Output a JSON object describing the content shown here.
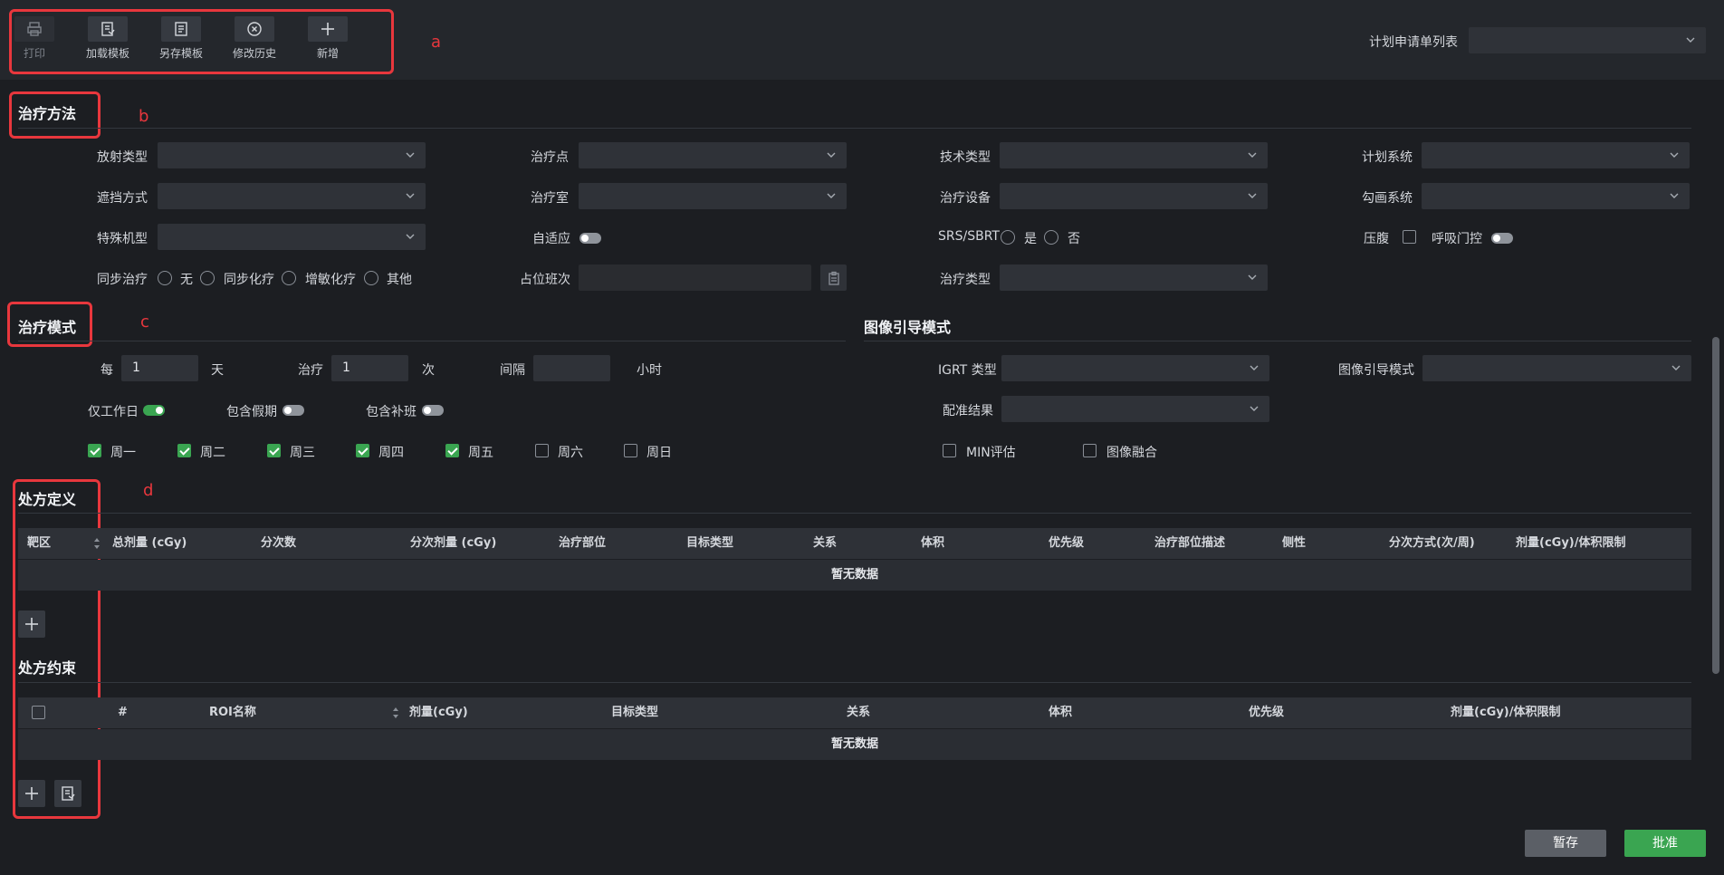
{
  "toolbar": {
    "print": "打印",
    "load_template": "加载模板",
    "save_template": "另存模板",
    "history": "修改历史",
    "add": "新增",
    "plan_list_label": "计划申请单列表"
  },
  "annotations": {
    "a": "a",
    "b": "b",
    "c": "c",
    "d": "d"
  },
  "treatment_method": {
    "title": "治疗方法",
    "radiation_type": "放射类型",
    "treatment_point": "治疗点",
    "technique_type": "技术类型",
    "planning_system": "计划系统",
    "shielding": "遮挡方式",
    "treatment_room": "治疗室",
    "treatment_device": "治疗设备",
    "contour_system": "勾画系统",
    "special_model": "特殊机型",
    "adaptive": "自适应",
    "srs_sbrt": "SRS/SBRT",
    "yes": "是",
    "no": "否",
    "abdominal_compression": "压腹",
    "respiratory_gating": "呼吸门控",
    "concurrent": "同步治疗",
    "none": "无",
    "concurrent_chemo": "同步化疗",
    "sensitized_chemo": "增敏化疗",
    "other": "其他",
    "placeholder_shift": "占位班次",
    "treatment_type": "治疗类型"
  },
  "treatment_mode": {
    "title": "治疗模式",
    "every": "每",
    "every_value": "1",
    "day": "天",
    "treat": "治疗",
    "treat_value": "1",
    "times": "次",
    "interval": "间隔",
    "interval_value": "",
    "hours": "小时",
    "workdays_only": "仅工作日",
    "include_holidays": "包含假期",
    "include_makeup": "包含补班",
    "weekdays": [
      "周一",
      "周二",
      "周三",
      "周四",
      "周五",
      "周六",
      "周日"
    ],
    "weekdays_checked": [
      true,
      true,
      true,
      true,
      true,
      false,
      false
    ]
  },
  "image_guidance": {
    "title": "图像引导模式",
    "igrt_type": "IGRT 类型",
    "igrt_mode": "图像引导模式",
    "registration": "配准结果",
    "min_eval": "MIN评估",
    "image_fusion": "图像融合"
  },
  "prescription": {
    "title": "处方定义",
    "columns": [
      "靶区",
      "总剂量 (cGy)",
      "分次数",
      "分次剂量 (cGy)",
      "治疗部位",
      "目标类型",
      "关系",
      "体积",
      "优先级",
      "治疗部位描述",
      "侧性",
      "分次方式(次/周)",
      "剂量(cGy)/体积限制"
    ],
    "empty": "暂无数据"
  },
  "constraints": {
    "title": "处方约束",
    "columns": [
      "#",
      "ROI名称",
      "剂量(cGy)",
      "目标类型",
      "关系",
      "体积",
      "优先级",
      "剂量(cGy)/体积限制"
    ],
    "empty": "暂无数据"
  },
  "footer": {
    "save_draft": "暂存",
    "approve": "批准"
  },
  "colors": {
    "accent_green": "#3aa551",
    "annotation_red": "#e8373d",
    "background": "#1c1e22"
  }
}
